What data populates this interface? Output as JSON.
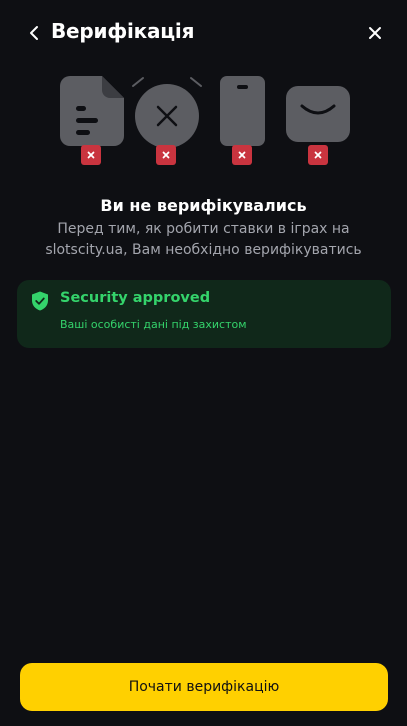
{
  "header": {
    "title": "Верифікація",
    "back_icon": "chevron-left-icon",
    "close_icon": "close-icon"
  },
  "illustration": {
    "items": [
      {
        "name": "document",
        "status": "not-verified",
        "badge_icon": "x-icon"
      },
      {
        "name": "selfie",
        "status": "not-verified",
        "badge_icon": "x-icon"
      },
      {
        "name": "phone",
        "status": "not-verified",
        "badge_icon": "x-icon"
      },
      {
        "name": "email",
        "status": "not-verified",
        "badge_icon": "x-icon"
      }
    ]
  },
  "message": {
    "title": "Ви не верифікувались",
    "text": "Перед тим, як робити ставки в іграх на slotscity.ua, Вам необхідно верифікуватись"
  },
  "security": {
    "title": "Security approved",
    "subtitle": "Ваші особисті дані під захистом",
    "icon": "shield-check-icon"
  },
  "actions": {
    "start_label": "Почати верифікацію"
  },
  "colors": {
    "background": "#0e0f13",
    "accent": "#ffd000",
    "success": "#34d36b",
    "error": "#c9343f",
    "icon_gray": "#5c5d62"
  }
}
